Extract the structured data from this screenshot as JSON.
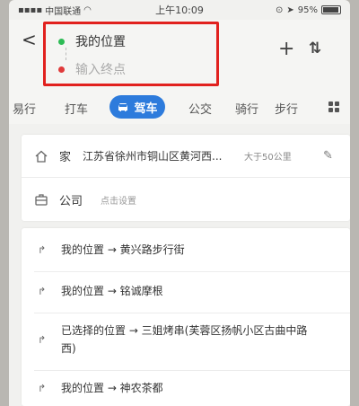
{
  "status": {
    "carrier": "中国联通",
    "time": "上午10:09",
    "battery": "95%"
  },
  "route": {
    "start": "我的位置",
    "end_placeholder": "输入终点"
  },
  "tabs": {
    "items": [
      "易行",
      "打车",
      "驾车",
      "公交",
      "骑行",
      "步行"
    ],
    "active": "驾车"
  },
  "favorites": {
    "home_label": "家",
    "home_address": "江苏省徐州市铜山区黄河西...",
    "home_distance": "大于50公里",
    "work_label": "公司",
    "work_hint": "点击设置"
  },
  "history": [
    "我的位置 → 黄兴路步行街",
    "我的位置 → 铭诚摩根",
    "已选择的位置 → 三姐烤串(芙蓉区扬帆小区古曲中路西)",
    "我的位置 → 神农茶都"
  ],
  "colors": {
    "accent": "#2d7bdc",
    "highlight_border": "#e1211e",
    "start_dot": "#2dbb55",
    "end_dot": "#e03a3a"
  }
}
